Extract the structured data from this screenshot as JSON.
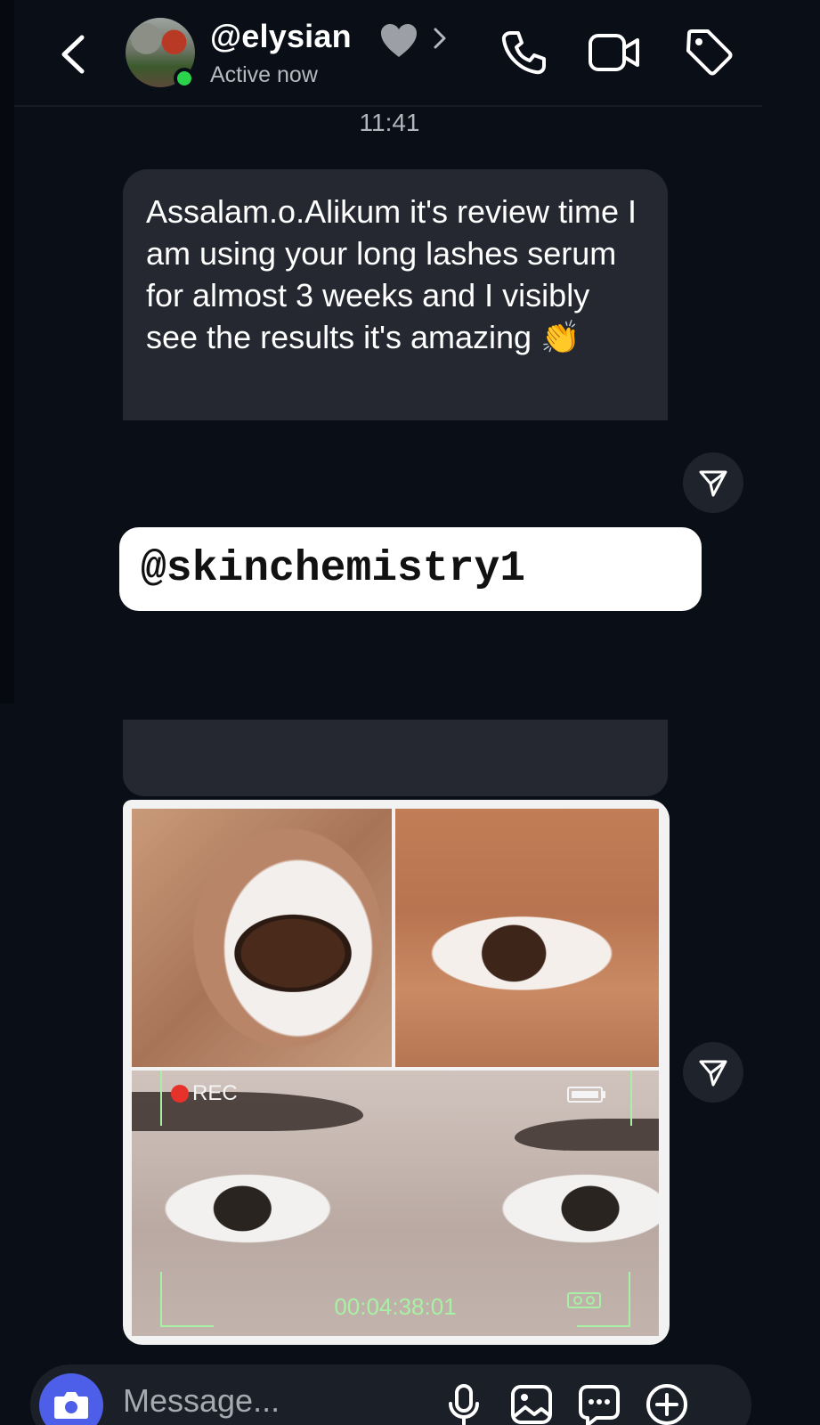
{
  "header": {
    "contact_name": "@elysian",
    "presence": "Active now",
    "icons": {
      "back": "chevron-left-icon",
      "heart": "grey-heart-icon",
      "profile": "chevron-right-icon",
      "call": "phone-icon",
      "video": "video-camera-icon",
      "tag": "tag-icon"
    }
  },
  "thread": {
    "timestamp": "11:41",
    "messages": [
      {
        "type": "text",
        "text": "Assalam.o.Alikum it's review time I am using your long lashes serum for almost 3 weeks and I visibly see the results it's amazing 👏"
      },
      {
        "type": "image",
        "overlay": {
          "rec_label": "REC",
          "timecode": "00:04:38:01"
        }
      }
    ],
    "watermark": "@skinchemistry1"
  },
  "composer": {
    "placeholder": "Message...",
    "icons": [
      "camera-icon",
      "microphone-icon",
      "gallery-icon",
      "sticker-icon",
      "plus-icon"
    ]
  },
  "colors": {
    "background": "#0a0e17",
    "bubble": "#252830",
    "online": "#2bd24b",
    "camera_accent": "#4d5fe8",
    "rec_red": "#e6322b",
    "viewfinder_green": "#a7f0a4"
  }
}
